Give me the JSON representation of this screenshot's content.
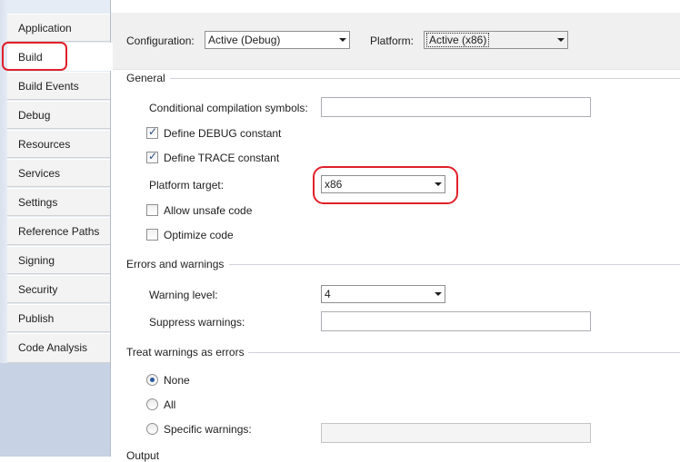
{
  "sidebar": {
    "tabs": [
      {
        "label": "Application"
      },
      {
        "label": "Build"
      },
      {
        "label": "Build Events"
      },
      {
        "label": "Debug"
      },
      {
        "label": "Resources"
      },
      {
        "label": "Services"
      },
      {
        "label": "Settings"
      },
      {
        "label": "Reference Paths"
      },
      {
        "label": "Signing"
      },
      {
        "label": "Security"
      },
      {
        "label": "Publish"
      },
      {
        "label": "Code Analysis"
      }
    ],
    "selected": "Build"
  },
  "top": {
    "configuration_label": "Configuration:",
    "configuration_value": "Active (Debug)",
    "platform_label": "Platform:",
    "platform_value": "Active (x86)"
  },
  "general": {
    "title": "General",
    "symbols_label": "Conditional compilation symbols:",
    "symbols_value": "",
    "define_debug_label": "Define DEBUG constant",
    "define_debug_checked": true,
    "define_trace_label": "Define TRACE constant",
    "define_trace_checked": true,
    "platform_target_label": "Platform target:",
    "platform_target_value": "x86",
    "allow_unsafe_label": "Allow unsafe code",
    "allow_unsafe_checked": false,
    "optimize_label": "Optimize code",
    "optimize_checked": false
  },
  "errors": {
    "title": "Errors and warnings",
    "warning_level_label": "Warning level:",
    "warning_level_value": "4",
    "suppress_label": "Suppress warnings:",
    "suppress_value": ""
  },
  "treat": {
    "title": "Treat warnings as errors",
    "options": [
      {
        "label": "None",
        "checked": true
      },
      {
        "label": "All",
        "checked": false
      },
      {
        "label": "Specific warnings:",
        "checked": false
      }
    ],
    "specific_value": ""
  },
  "output": {
    "title": "Output"
  },
  "colors": {
    "highlight": "#e0202a",
    "sidebar_bg": "#e6ecf5"
  }
}
